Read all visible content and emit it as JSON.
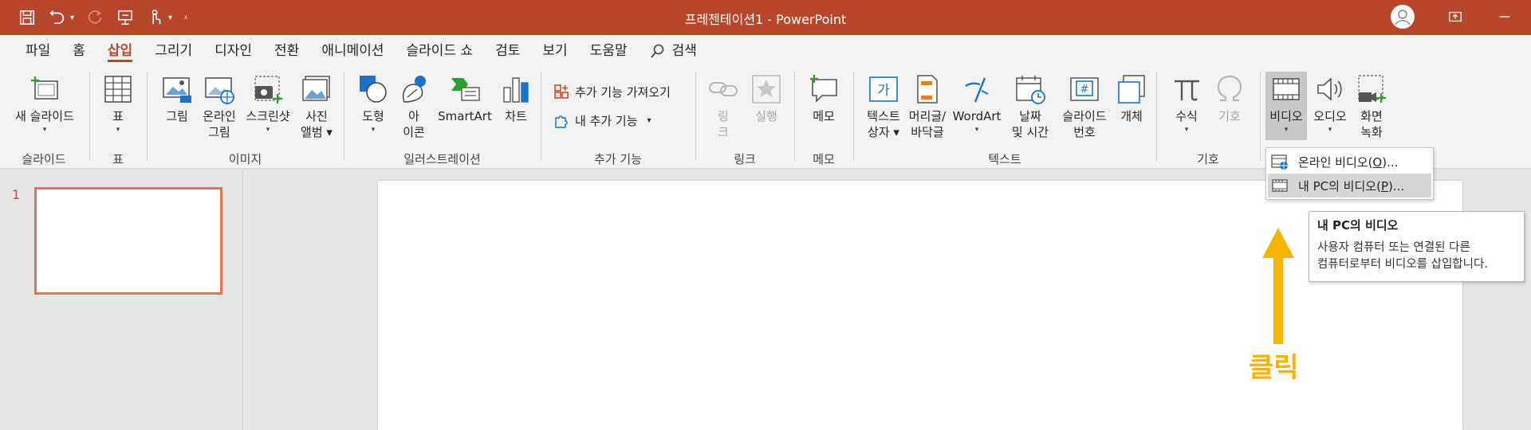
{
  "titlebar": {
    "title": "프레젠테이션1  -  PowerPoint",
    "bg_color": "#b7472a",
    "qat_icons": [
      "save-icon",
      "undo-icon",
      "redo-icon",
      "present-icon",
      "touch-mode-icon",
      "customize-icon"
    ],
    "window_controls": [
      "user-avatar-icon",
      "ribbon-display-icon",
      "minimize-icon"
    ]
  },
  "tabs": [
    {
      "label": "파일"
    },
    {
      "label": "홈"
    },
    {
      "label": "삽입",
      "active": true
    },
    {
      "label": "그리기"
    },
    {
      "label": "디자인"
    },
    {
      "label": "전환"
    },
    {
      "label": "애니메이션"
    },
    {
      "label": "슬라이드 쇼"
    },
    {
      "label": "검토"
    },
    {
      "label": "보기"
    },
    {
      "label": "도움말"
    }
  ],
  "search": {
    "label": "검색"
  },
  "ribbon": {
    "slides": {
      "group_label": "슬라이드",
      "new_slide": "새 슬라이드"
    },
    "table": {
      "group_label": "표",
      "table": "표"
    },
    "images": {
      "group_label": "이미지",
      "picture": "그림",
      "online_pic_1": "온라인",
      "online_pic_2": "그림",
      "screenshot": "스크린샷",
      "album_1": "사진",
      "album_2": "앨범"
    },
    "illustrations": {
      "group_label": "일러스트레이션",
      "shapes": "도형",
      "icons_1": "아",
      "icons_2": "이콘",
      "smartart": "SmartArt",
      "chart": "차트"
    },
    "addins": {
      "group_label": "추가 기능",
      "get_addins": "추가 기능 가져오기",
      "my_addins": "내 추가 기능"
    },
    "links": {
      "group_label": "링크",
      "link_1": "링",
      "link_2": "크",
      "action": "실행"
    },
    "comments": {
      "group_label": "메모",
      "comment": "메모"
    },
    "text": {
      "group_label": "텍스트",
      "textbox_1": "텍스트",
      "textbox_2": "상자",
      "header_1": "머리글/",
      "header_2": "바닥글",
      "wordart": "WordArt",
      "date_1": "날짜",
      "date_2": "및 시간",
      "slidenum_1": "슬라이드",
      "slidenum_2": "번호",
      "object": "개체"
    },
    "symbols": {
      "group_label": "기호",
      "equation": "수식",
      "symbol": "기호"
    },
    "media": {
      "video": "비디오",
      "audio": "오디오",
      "rec_1": "화면",
      "rec_2": "녹화"
    }
  },
  "video_menu": {
    "online_video": "온라인 비디오(",
    "online_key": "O",
    "online_tail": ")...",
    "pc_video_prefix": "내 ",
    "pc_video_pc": "PC",
    "pc_video_rest": "의 비디오(",
    "pc_key": "P",
    "pc_tail": ")..."
  },
  "tooltip": {
    "title_prefix": "내 ",
    "title_pc": "PC",
    "title_rest": "의 비디오",
    "line1": "사용자 컴퓨터 또는 연결된 다른",
    "line2": "컴퓨터로부터 비디오를 삽입합니다."
  },
  "slide_pane": {
    "slide_number": "1"
  },
  "annotation": {
    "label": "클릭",
    "color": "#f5b400"
  }
}
